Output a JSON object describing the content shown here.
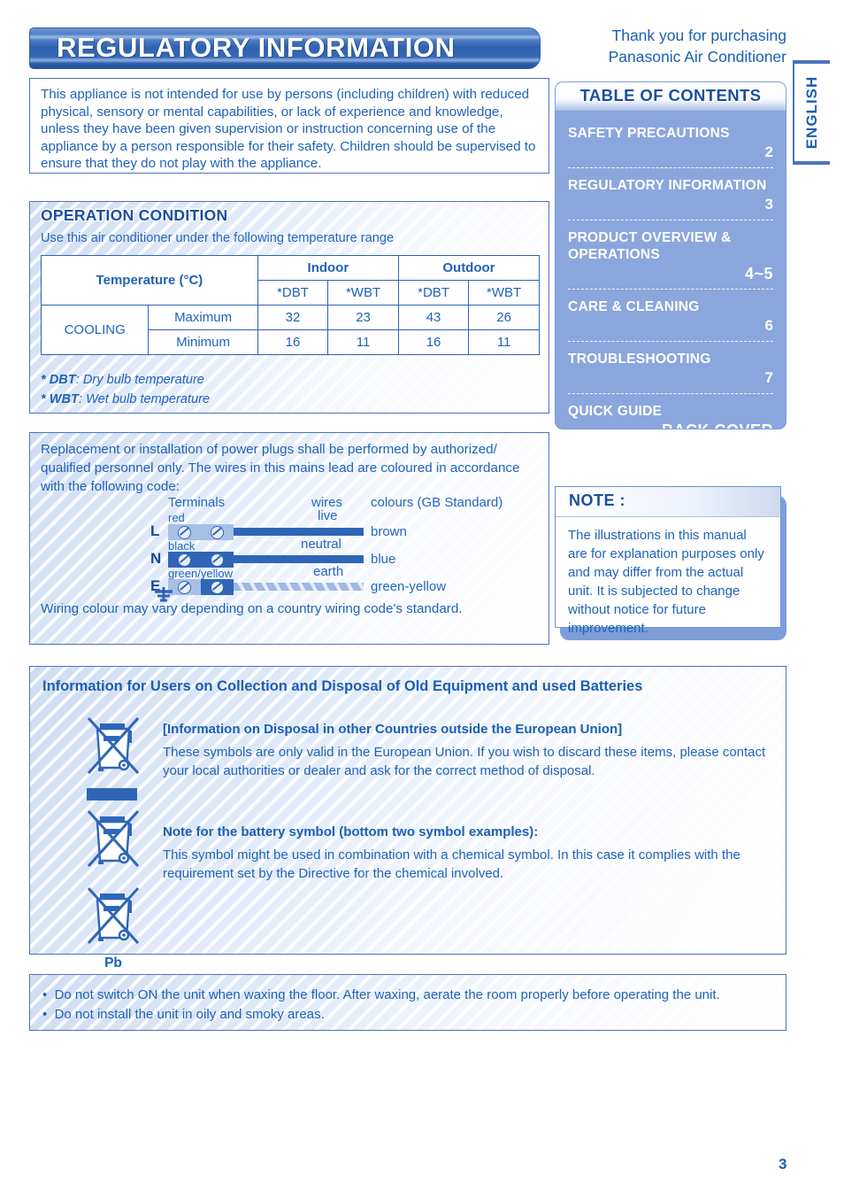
{
  "header": {
    "banner_title": "REGULATORY INFORMATION",
    "thank_you_line1": "Thank you for purchasing",
    "thank_you_line2": "Panasonic Air Conditioner",
    "language_tab": "ENGLISH"
  },
  "intro": {
    "text": "This appliance is not intended for use by persons (including children) with reduced physical, sensory or mental capabilities, or lack of experience and knowledge, unless they have been given supervision or instruction concerning use of the appliance by a person responsible for their safety. Children should be supervised to ensure that they do not play with the appliance."
  },
  "toc": {
    "title": "TABLE OF CONTENTS",
    "items": [
      {
        "label": "SAFETY PRECAUTIONS",
        "page": "2"
      },
      {
        "label": "REGULATORY INFORMATION",
        "page": "3"
      },
      {
        "label": "PRODUCT OVERVIEW & OPERATIONS",
        "page": "4~5"
      },
      {
        "label": "CARE & CLEANING",
        "page": "6"
      },
      {
        "label": "TROUBLESHOOTING",
        "page": "7"
      },
      {
        "label": "QUICK GUIDE",
        "page": "BACK COVER"
      }
    ]
  },
  "operation_condition": {
    "heading": "OPERATION CONDITION",
    "subheading": "Use this air conditioner under the following temperature range",
    "table": {
      "corner_header": "Temperature (°C)",
      "group_headers": [
        "Indoor",
        "Outdoor"
      ],
      "sub_headers": [
        "*DBT",
        "*WBT",
        "*DBT",
        "*WBT"
      ],
      "mode": "COOLING",
      "rows": [
        {
          "label": "Maximum",
          "values": [
            "32",
            "23",
            "43",
            "26"
          ]
        },
        {
          "label": "Minimum",
          "values": [
            "16",
            "11",
            "16",
            "11"
          ]
        }
      ]
    },
    "footnotes": [
      {
        "abbr": "* DBT",
        "text": ":  Dry bulb temperature"
      },
      {
        "abbr": "* WBT",
        "text": ":  Wet bulb temperature"
      }
    ]
  },
  "power_plugs": {
    "text": "Replacement or installation of power plugs shall be performed by authorized/ qualified personnel only. The wires in this mains lead are coloured in accordance with the following code:",
    "diagram": {
      "col_terminals": "Terminals",
      "col_wires": "wires",
      "col_colours": "colours (GB Standard)",
      "rows": [
        {
          "letter": "L",
          "terminal_colour": "red",
          "wire": "live",
          "colour": "brown"
        },
        {
          "letter": "N",
          "terminal_colour": "black",
          "wire": "neutral",
          "colour": "blue"
        },
        {
          "letter": "E",
          "terminal_colour": "green/yellow",
          "wire": "earth",
          "colour": "green-yellow"
        }
      ]
    },
    "footer": "Wiring colour may vary depending on a country wiring code's standard."
  },
  "note": {
    "title": "NOTE :",
    "body": "The illustrations in this manual are for explanation purposes only and may differ from the actual unit. It is subjected to change without notice for future improvement."
  },
  "disposal": {
    "title": "Information for Users on Collection and Disposal of Old Equipment and used Batteries",
    "section1_heading": "[Information on Disposal in other Countries outside the European Union]",
    "section1_body": "These symbols are only valid in the European Union. If you wish to discard these items, please contact your local authorities or dealer and ask for the correct method of disposal.",
    "section2_heading": "Note for the battery symbol (bottom two symbol examples):",
    "section2_body": "This symbol might be used in combination with a chemical symbol. In this case it complies with the requirement set by the Directive for the chemical involved.",
    "battery_chemical_label": "Pb"
  },
  "warnings": {
    "items": [
      "Do not switch ON the unit when waxing the floor. After waxing, aerate the room properly before operating the unit.",
      "Do not install the unit in oily and smoky areas."
    ]
  },
  "footer": {
    "page_number": "3"
  }
}
